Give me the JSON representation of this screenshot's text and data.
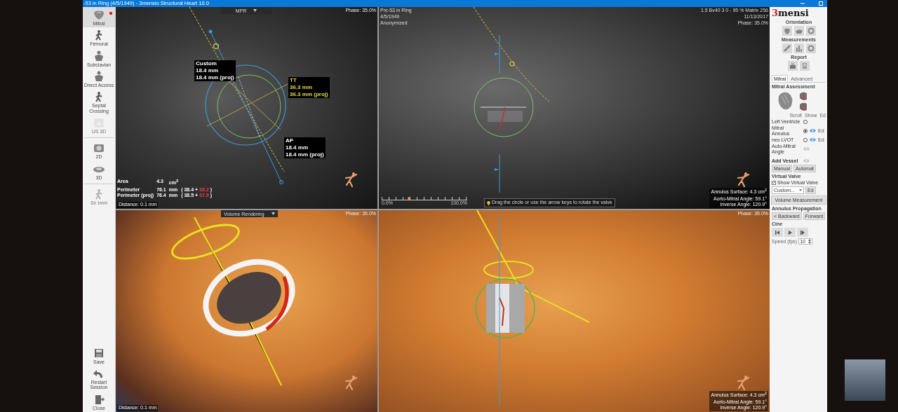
{
  "window": {
    "title": "-53 in Ring (4/5/1949) - 3mensio Structural Heart 10.0"
  },
  "toolbar": {
    "items": [
      {
        "kind": "heart",
        "label": "Mitral",
        "selected": true,
        "disabled": false
      },
      {
        "kind": "walker",
        "label": "Femoral",
        "selected": false,
        "disabled": false
      },
      {
        "kind": "torso",
        "label": "Subclavian",
        "selected": false,
        "disabled": false
      },
      {
        "kind": "torso",
        "label": "Direct Access",
        "selected": false,
        "disabled": false
      },
      {
        "kind": "walker",
        "label": "Septal Crossing",
        "selected": false,
        "disabled": false
      },
      {
        "kind": "cube",
        "label": "US 3D",
        "selected": false,
        "disabled": true
      },
      {
        "kind": "slice",
        "label": "2D",
        "selected": false,
        "disabled": false
      },
      {
        "kind": "volume",
        "label": "3D",
        "selected": false,
        "disabled": false
      },
      {
        "kind": "walker",
        "label": "Sn Imm",
        "selected": false,
        "disabled": true
      }
    ],
    "bottom_items": [
      {
        "kind": "save",
        "label": "Save"
      },
      {
        "kind": "undo",
        "label": "Restart Session"
      },
      {
        "kind": "exit",
        "label": "Close"
      }
    ]
  },
  "viewports": [
    {
      "kind": "mpr",
      "dropdown": "MPR",
      "phase": "Phase: 35.0%",
      "labels": [
        {
          "lines": [
            "Custom",
            "18.4 mm",
            "18.4 mm (proj)"
          ],
          "kind": "plain"
        },
        {
          "lines": [
            "TT",
            "36.3 mm",
            "36.3 mm (proj)"
          ],
          "kind": "highlight"
        },
        {
          "lines": [
            "AP",
            "18.4 mm",
            "18.4 mm (proj)"
          ],
          "kind": "plain"
        }
      ],
      "stats": [
        {
          "label": "Area",
          "value": "4.3",
          "unit": "cm$^{2}$"
        },
        {
          "label": "Perimeter",
          "value": "76.1",
          "unit": "mm",
          "open": "( 38.4 +",
          "red": "38.2",
          "close": ")"
        },
        {
          "label": "Perimeter (proj)",
          "value": "76.4",
          "unit": "mm",
          "open": "( 38.5 +",
          "red": "37.9",
          "close": ")"
        }
      ],
      "distance": "Distance: 0.1 mm"
    },
    {
      "kind": "long_axis",
      "patient": [
        "Pre-53 in Ring",
        "4/5/1949",
        "Anonymized"
      ],
      "acquisition": [
        "1.5  Bv40  3  0 - 95 %  Matrix 256",
        "11/13/2017",
        "Phase: 35.0%"
      ],
      "slider": {
        "min": "0.0%",
        "max": "100.0%",
        "level": 0.32
      },
      "hint": "Drag the circle or use the arrow keys to rotate the valve",
      "measures": [
        "Annulus Surface: 4.3 cm$^{2}$",
        "Aorto-Mitral Angle: 59.1°",
        "Inverse Angle: 120.9°"
      ]
    },
    {
      "kind": "volume_top",
      "dropdown": "Volume Rendering",
      "phase": "Phase: 35.0%",
      "distance": "Distance: 0.1 mm"
    },
    {
      "kind": "volume_side",
      "phase": "Phase: 35.0%",
      "measures": [
        "Annulus Surface: 4.3 cm$^{2}$",
        "Aorto-Mitral Angle: 59.1°",
        "Inverse Angle: 120.9°"
      ]
    }
  ],
  "panel": {
    "logo": {
      "digit": "3",
      "word": "mensi"
    },
    "orientation": "Orientation",
    "measurements": "Measurements",
    "report": "Report",
    "tabs": [
      {
        "label": "Mitral",
        "selected": true
      },
      {
        "label": "Advanced",
        "selected": false
      }
    ],
    "assessment": "Mitral Assessment",
    "view_options": [
      "Scroll",
      "Show",
      "Ed"
    ],
    "structures": [
      {
        "kind": "radio",
        "label": "Left Ventricle",
        "selected": false
      },
      {
        "kind": "radio",
        "label": "Mitral Annulus",
        "selected": true,
        "visible": true,
        "edit": "Ed"
      },
      {
        "kind": "radio",
        "label": "neo LVOT",
        "selected": false,
        "visible": true,
        "edit": "Ed"
      },
      {
        "kind": "toggle",
        "label": "Auto-Mitral Angle",
        "visible": false
      }
    ],
    "add_vessel": {
      "label": "Add Vessel",
      "visible": false,
      "buttons": [
        "Manual",
        "Automat"
      ]
    },
    "virtual_valve": {
      "heading": "Virtual Valve",
      "show_label": "Show Virtual Valve",
      "checked": true,
      "dropdown": "Custom...",
      "button": "Ed"
    },
    "volume_button": "Volume Measurement",
    "propagation": {
      "heading": "Annulus Propagation",
      "buttons": [
        "< Backward",
        "Forward"
      ]
    },
    "cine": {
      "heading": "Cine",
      "speed_label": "Speed (fps)",
      "speed": "10"
    }
  }
}
